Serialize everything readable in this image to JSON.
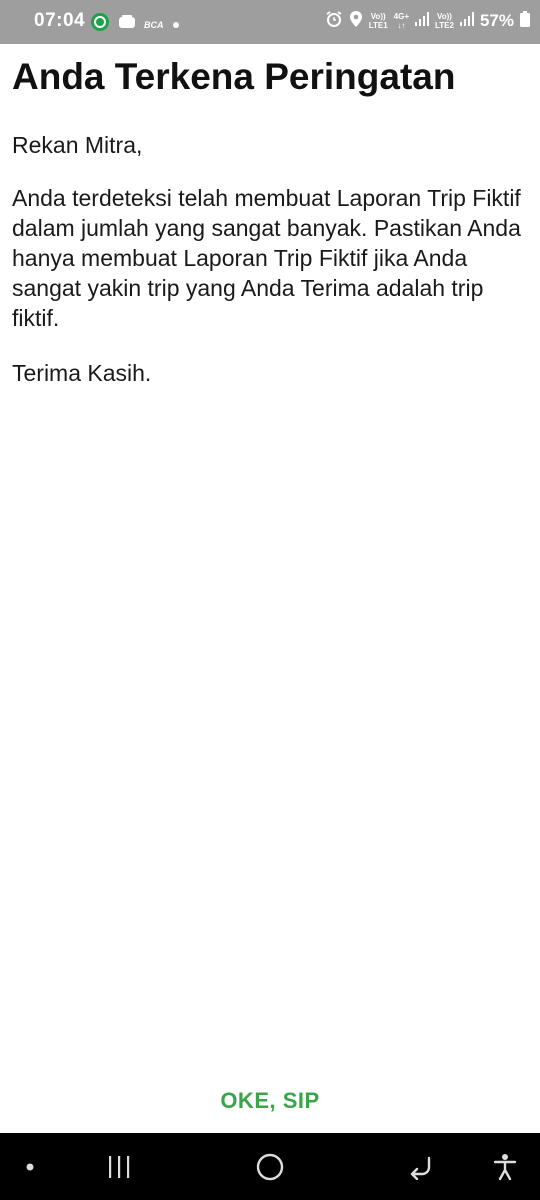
{
  "status_bar": {
    "time": "07:04",
    "notification_icons": [
      "circle-app-icon",
      "wallet-icon",
      "bca-icon",
      "dot-icon"
    ],
    "bca_label": "BCA",
    "network_icons": [
      "alarm-icon",
      "location-icon"
    ],
    "sim1_label_top": "Vo))",
    "sim1_label_bottom": "LTE1",
    "data_label_top": "4G+",
    "data_label_bottom": "↓↑",
    "sim2_label_top": "Vo))",
    "sim2_label_bottom": "LTE2",
    "battery": "57%"
  },
  "dialog": {
    "title": "Anda Terkena Peringatan",
    "greeting": "Rekan Mitra,",
    "body": "Anda terdeteksi telah membuat Laporan Trip Fiktif dalam jumlah yang sangat banyak. Pastikan Anda hanya membuat Laporan Trip Fiktif jika Anda sangat yakin trip yang Anda Terima adalah trip fiktif.",
    "closing": "Terima Kasih.",
    "ok_label": "OKE, SIP"
  },
  "colors": {
    "accent": "#3aa449",
    "status_bar": "#9e9e9e",
    "nav_bar": "#000000"
  },
  "nav_bar": {
    "icons": [
      "dot-icon",
      "recent-apps-icon",
      "home-icon",
      "back-icon",
      "accessibility-icon"
    ]
  }
}
